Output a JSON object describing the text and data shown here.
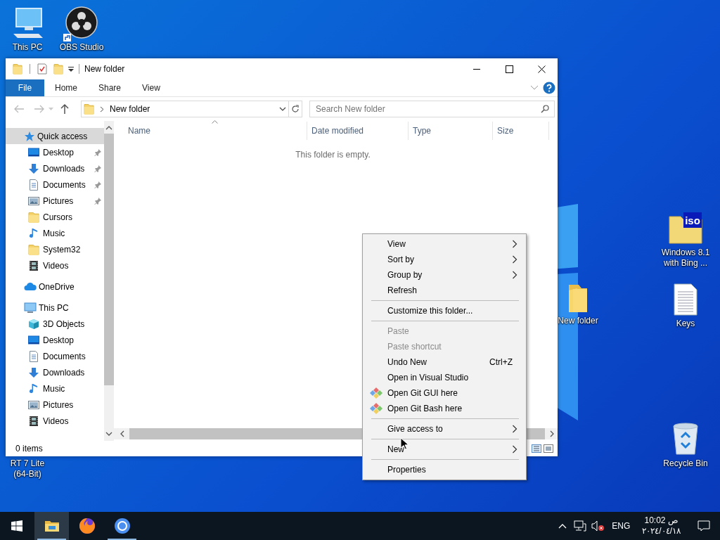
{
  "desktop_icons": [
    {
      "kind": "pc",
      "label": "This PC"
    },
    {
      "kind": "obs",
      "label": "OBS Studio",
      "shortcut": true
    },
    {
      "kind": "iso",
      "label": "Windows 8.1 with Bing ...",
      "badge": "iso"
    },
    {
      "kind": "folder",
      "label": "New folder"
    },
    {
      "kind": "text",
      "label": "Keys"
    },
    {
      "kind": "recycle",
      "label": "Recycle Bin"
    },
    {
      "label": "RT 7 Lite (64-Bit)"
    }
  ],
  "window": {
    "title": "New folder",
    "ribbon_tabs": [
      {
        "label": "File",
        "selected": true
      },
      {
        "label": "Home",
        "selected": false
      },
      {
        "label": "Share",
        "selected": false
      },
      {
        "label": "View",
        "selected": false
      }
    ],
    "address": "New folder",
    "search": {
      "placeholder": "Search New folder"
    },
    "sidebar": {
      "items": [
        {
          "label": "Quick access",
          "kind": "star",
          "selected": true,
          "children": [
            {
              "label": "Desktop",
              "kind": "desktop",
              "pinned": true,
              "selected": false
            },
            {
              "label": "Downloads",
              "kind": "downloads",
              "pinned": true,
              "selected": false
            },
            {
              "label": "Documents",
              "kind": "documents",
              "pinned": true,
              "selected": false
            },
            {
              "label": "Pictures",
              "kind": "pictures",
              "pinned": true,
              "selected": false
            },
            {
              "label": "Cursors",
              "kind": "folder",
              "pinned": false,
              "selected": false
            },
            {
              "label": "Music",
              "kind": "music",
              "pinned": false,
              "selected": false
            },
            {
              "label": "System32",
              "kind": "folder",
              "pinned": false,
              "selected": false
            },
            {
              "label": "Videos",
              "kind": "videos",
              "pinned": false,
              "selected": false
            }
          ]
        },
        {
          "label": "OneDrive",
          "kind": "onedrive",
          "selected": false
        },
        {
          "label": "This PC",
          "kind": "thispc",
          "selected": false,
          "children": [
            {
              "label": "3D Objects",
              "kind": "objects3d",
              "pinned": false,
              "selected": false
            },
            {
              "label": "Desktop",
              "kind": "desktop",
              "pinned": false,
              "selected": false
            },
            {
              "label": "Documents",
              "kind": "documents",
              "pinned": false,
              "selected": false
            },
            {
              "label": "Downloads",
              "kind": "downloads",
              "pinned": false,
              "selected": false
            },
            {
              "label": "Music",
              "kind": "music",
              "pinned": false,
              "selected": false
            },
            {
              "label": "Pictures",
              "kind": "pictures",
              "pinned": false,
              "selected": false
            },
            {
              "label": "Videos",
              "kind": "videos",
              "pinned": false,
              "selected": false
            }
          ]
        }
      ]
    },
    "columns": [
      {
        "label": "Name",
        "sorted": true
      },
      {
        "label": "Date modified",
        "sorted": false
      },
      {
        "label": "Type",
        "sorted": false
      },
      {
        "label": "Size",
        "sorted": false
      }
    ],
    "empty_message": "This folder is empty.",
    "status_bar": "0 items"
  },
  "context_menu": [
    {
      "kind": "item",
      "label": "View",
      "submenu": true,
      "disabled": false
    },
    {
      "kind": "item",
      "label": "Sort by",
      "submenu": true,
      "disabled": false
    },
    {
      "kind": "item",
      "label": "Group by",
      "submenu": true,
      "disabled": false
    },
    {
      "kind": "item",
      "label": "Refresh",
      "submenu": false,
      "disabled": false
    },
    {
      "kind": "separator"
    },
    {
      "kind": "item",
      "label": "Customize this folder...",
      "submenu": false,
      "disabled": false
    },
    {
      "kind": "separator"
    },
    {
      "kind": "item",
      "label": "Paste",
      "submenu": false,
      "disabled": true
    },
    {
      "kind": "item",
      "label": "Paste shortcut",
      "submenu": false,
      "disabled": true
    },
    {
      "kind": "item",
      "label": "Undo New",
      "submenu": false,
      "disabled": false,
      "shortcut": "Ctrl+Z"
    },
    {
      "kind": "item",
      "label": "Open in Visual Studio",
      "submenu": false,
      "disabled": false
    },
    {
      "kind": "git",
      "label": "Open Git GUI here",
      "submenu": false,
      "disabled": false
    },
    {
      "kind": "git",
      "label": "Open Git Bash here",
      "submenu": false,
      "disabled": false
    },
    {
      "kind": "separator"
    },
    {
      "kind": "item",
      "label": "Give access to",
      "submenu": true,
      "disabled": false
    },
    {
      "kind": "separator"
    },
    {
      "kind": "item",
      "label": "New",
      "submenu": true,
      "disabled": false
    },
    {
      "kind": "separator"
    },
    {
      "kind": "item",
      "label": "Properties",
      "submenu": false,
      "disabled": false
    }
  ],
  "taskbar": {
    "apps": [
      {
        "kind": "start",
        "running": false,
        "focused": false
      },
      {
        "kind": "explorer",
        "running": true,
        "focused": true
      },
      {
        "kind": "firefox",
        "running": false,
        "focused": false
      },
      {
        "kind": "chrome",
        "running": true,
        "focused": false
      }
    ],
    "tray": {
      "volume_muted": true,
      "language": "ENG",
      "time": "ص 10:02",
      "date": "٢٠٢٤/٠٤/١٨"
    }
  }
}
